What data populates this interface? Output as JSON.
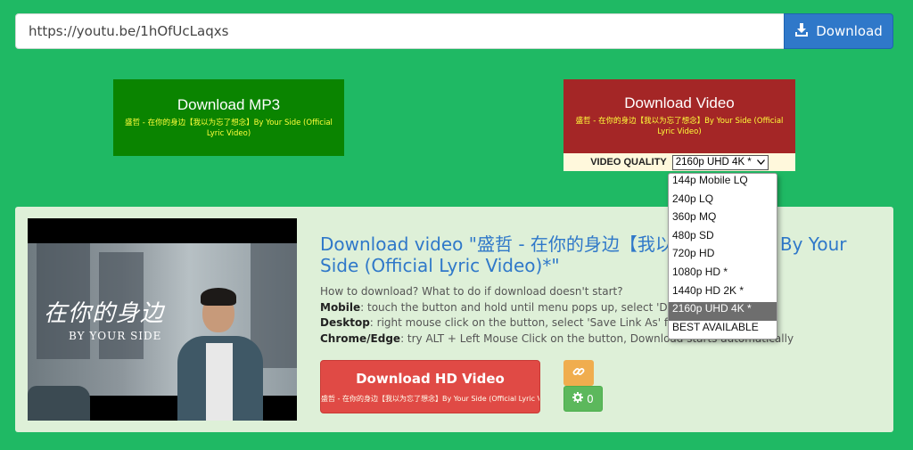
{
  "url_bar": {
    "value": "https://youtu.be/1hOfUcLaqxs",
    "button_label": "Download"
  },
  "mp3": {
    "title": "Download MP3",
    "subtitle": "盛哲 - 在你的身边【我以为忘了想念】By Your Side (Official Lyric Video)"
  },
  "video": {
    "title": "Download Video",
    "subtitle": "盛哲 - 在你的身边【我以为忘了想念】By Your Side (Official Lyric Video)",
    "quality_label": "VIDEO QUALITY",
    "quality_selected": "2160p UHD 4K *",
    "quality_options": [
      "144p Mobile LQ",
      "240p LQ",
      "360p MQ",
      "480p SD",
      "720p HD",
      "1080p HD *",
      "1440p HD 2K *",
      "2160p UHD 4K *",
      "BEST AVAILABLE"
    ],
    "selected_index": 7
  },
  "thumbnail": {
    "title_cn": "在你的身边",
    "title_en": "BY YOUR SIDE"
  },
  "details": {
    "title": "Download video \"盛哲 - 在你的身边【我以为忘了想念】By Your Side (Official Lyric Video)*\"",
    "help_intro": "How to download? What to do if download doesn't start?",
    "mobile_label": "Mobile",
    "mobile_text": ": touch the button and hold until menu pops up, select 'Download Link'",
    "desktop_label": "Desktop",
    "desktop_text": ": right mouse click on the button, select 'Save Link As' from the menu",
    "chrome_label": "Chrome/Edge",
    "chrome_text": ": try ALT + Left Mouse Click on the button, Download starts automatically"
  },
  "hd_button": {
    "title": "Download HD Video",
    "subtitle": "盛哲 - 在你的身边【我以为忘了想念】By Your Side (Official Lyric Video)"
  },
  "gear_count": "0",
  "colors": {
    "background": "#1fb964",
    "accent": "#2f78c9",
    "mp3": "#0a8400",
    "video": "#a42626",
    "hd": "#e04a45"
  }
}
